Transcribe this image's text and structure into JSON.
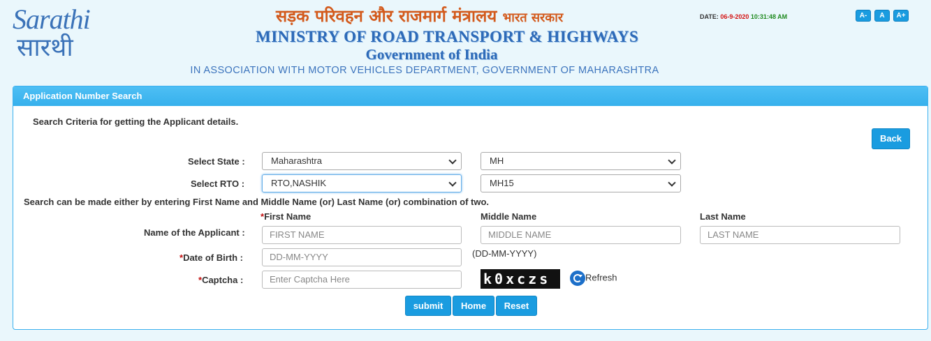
{
  "header": {
    "logo_en": "Sarathi",
    "logo_hi": "सारथी",
    "hindi_title": "सड़क परिवहन और राजमार्ग मंत्रालय",
    "hindi_sub": "भारत सरकार",
    "ministry": "MINISTRY OF ROAD TRANSPORT & HIGHWAYS",
    "govt": "Government of India",
    "association": "IN ASSOCIATION WITH MOTOR VEHICLES DEPARTMENT, GOVERNMENT OF MAHARASHTRA",
    "date_label": "DATE:",
    "date_value": "06-9-2020",
    "time_value": "10:31:48 AM",
    "font_buttons": [
      "A-",
      "A",
      "A+"
    ]
  },
  "panel": {
    "title": "Application Number Search",
    "criteria_text": "Search Criteria for getting the Applicant details.",
    "back_label": "Back",
    "state_label": "Select State :",
    "state_value": "Maharashtra",
    "state_code": "MH",
    "rto_label": "Select RTO :",
    "rto_value": "RTO,NASHIK",
    "rto_code": "MH15",
    "search_note": "Search can be made either by entering First Name and Middle Name (or) Last Name (or) combination of two.",
    "first_name_header": "First Name",
    "middle_name_header": "Middle Name",
    "last_name_header": "Last Name",
    "applicant_label": "Name of the Applicant :",
    "first_name_placeholder": "FIRST NAME",
    "middle_name_placeholder": "MIDDLE NAME",
    "last_name_placeholder": "LAST NAME",
    "dob_label": "Date of Birth :",
    "dob_placeholder": "DD-MM-YYYY",
    "dob_hint": "(DD-MM-YYYY)",
    "captcha_label": "Captcha :",
    "captcha_placeholder": "Enter Captcha Here",
    "captcha_text": "k0xczs",
    "refresh_label": "Refresh",
    "required_mark": "*",
    "submit_label": "submit",
    "home_label": "Home",
    "reset_label": "Reset"
  },
  "colors": {
    "accent": "#1a9ce0",
    "panel_header": "#3ab0ef",
    "required": "#c21010",
    "date": "#d41414",
    "time": "#1f8a1f"
  }
}
